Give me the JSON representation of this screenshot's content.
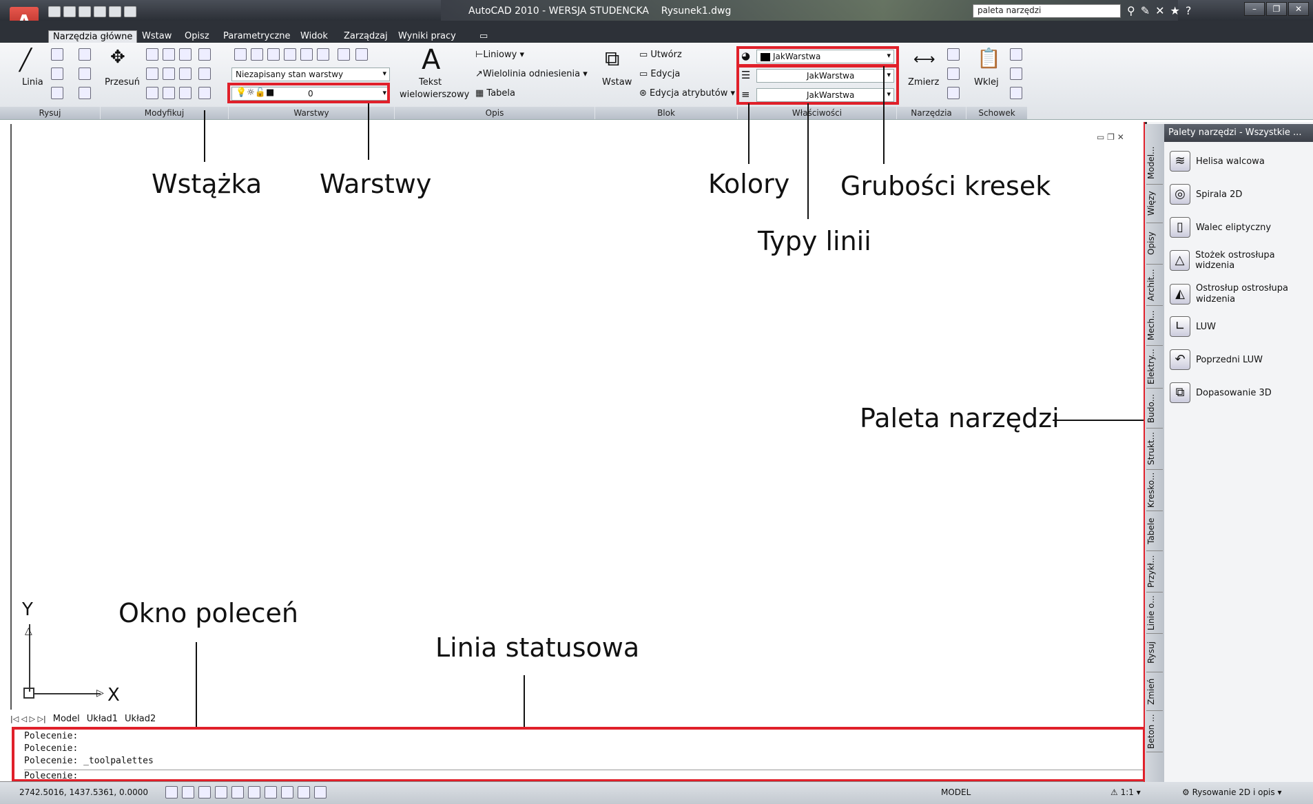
{
  "app": {
    "title": "AutoCAD 2010 - WERSJA STUDENCKA",
    "file": "Rysunek1.dwg",
    "search_value": "paleta narzędzi",
    "app_button": "A"
  },
  "tabs": [
    "Narzędzia główne",
    "Wstaw",
    "Opisz",
    "Parametryczne",
    "Widok",
    "Zarządzaj",
    "Wyniki pracy"
  ],
  "ribbon": {
    "draw": {
      "line": "Linia",
      "label": "Rysuj"
    },
    "modify": {
      "move": "Przesuń",
      "label": "Modyfikuj"
    },
    "layers": {
      "state": "Niezapisany stan warstwy",
      "current": "0",
      "label": "Warstwy"
    },
    "annotation": {
      "text_line1": "Tekst",
      "text_line2": "wielowierszowy",
      "linear": "Liniowy",
      "multileader": "Wielolinia odniesienia",
      "table": "Tabela",
      "label": "Opis"
    },
    "block": {
      "insert": "Wstaw",
      "create": "Utwórz",
      "edit": "Edycja",
      "edit_attr": "Edycja atrybutów",
      "label": "Blok"
    },
    "properties": {
      "color": "JakWarstwa",
      "linetype": "JakWarstwa",
      "lineweight": "JakWarstwa",
      "label": "Właściwości"
    },
    "utilities": {
      "measure": "Zmierz",
      "label": "Narzędzia"
    },
    "clipboard": {
      "paste": "Wklej",
      "label": "Schowek"
    }
  },
  "annotations": {
    "ribbon": "Wstążka",
    "layers": "Warstwy",
    "colors": "Kolory",
    "lineweights": "Grubości kresek",
    "linetypes": "Typy linii",
    "palette": "Paleta narzędzi",
    "command_window": "Okno poleceń",
    "status_line": "Linia statusowa"
  },
  "ucs": {
    "y": "Y",
    "x": "X"
  },
  "layout_tabs": [
    "Model",
    "Układ1",
    "Układ2"
  ],
  "command_lines": [
    "Polecenie:",
    "Polecenie:",
    "Polecenie:  _toolpalettes",
    "Polecenie:"
  ],
  "status": {
    "coords": "2742.5016, 1437.5361, 0.0000",
    "model": "MODEL",
    "scale": "1:1",
    "workspace": "Rysowanie 2D i opis"
  },
  "palette": {
    "title": "Palety narzędzi - Wszystkie ...",
    "tabs": [
      "Model...",
      "Więzy",
      "Opisy",
      "Archit...",
      "Mech...",
      "Elektry...",
      "Budo...",
      "Strukt...",
      "Kresko...",
      "Tabele",
      "Przykł...",
      "Linie o...",
      "Rysuj",
      "Zmień",
      "Beton ..."
    ],
    "items": [
      {
        "label": "Helisa walcowa",
        "icon": "helix-icon"
      },
      {
        "label": "Spirala 2D",
        "icon": "spiral-icon"
      },
      {
        "label": "Walec eliptyczny",
        "icon": "cylinder-icon"
      },
      {
        "label": "Stożek ostrosłupa widzenia",
        "icon": "cone-icon"
      },
      {
        "label": "Ostrosłup ostrosłupa",
        "label2": "widzenia",
        "icon": "pyramid-icon"
      },
      {
        "label": "LUW",
        "icon": "ucs-icon"
      },
      {
        "label": "Poprzedni LUW",
        "icon": "ucs-previous-icon"
      },
      {
        "label": "Dopasowanie 3D",
        "icon": "align-3d-icon"
      }
    ]
  },
  "colors": {
    "highlight": "#e0202a",
    "ribbon_bg": "#e6e9ee",
    "dark_bar": "#2d3138"
  }
}
